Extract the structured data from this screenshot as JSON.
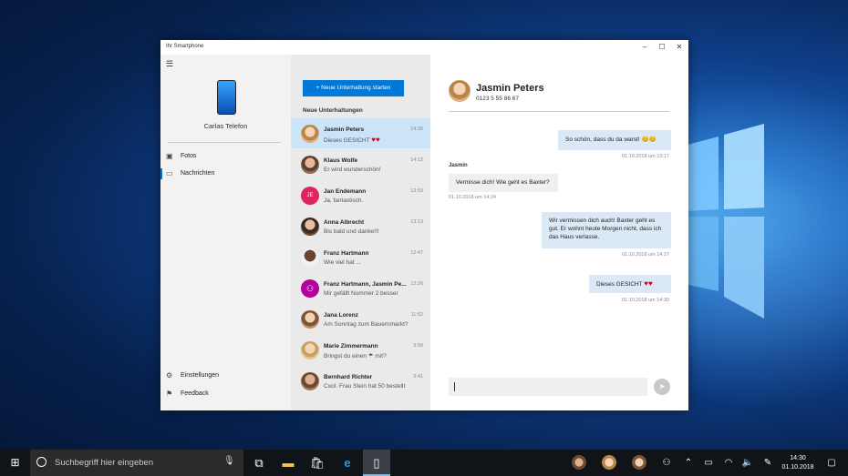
{
  "window": {
    "title": "Ihr Smartphone",
    "controls": {
      "minimize": "–",
      "maximize": "☐",
      "close": "✕"
    }
  },
  "sidebar": {
    "menu_icon": "hamburger-icon",
    "phone_name": "Carlas Telefon",
    "nav": [
      {
        "label": "Fotos",
        "icon": "photo-icon"
      },
      {
        "label": "Nachrichten",
        "icon": "message-icon"
      }
    ],
    "bottom": [
      {
        "label": "Einstellungen",
        "icon": "gear-icon"
      },
      {
        "label": "Feedback",
        "icon": "feedback-icon"
      }
    ]
  },
  "list": {
    "new_button": "Neue Unterhaltung starten",
    "header": "Neue Unterhaltungen",
    "items": [
      {
        "name": "Jasmin Peters",
        "preview": "Dieses GESICHT",
        "time": "14:30",
        "avatar": "photo",
        "selected": true,
        "hearts": true
      },
      {
        "name": "Klaus Wolfe",
        "preview": "Er wird wunderschön!",
        "time": "14:12",
        "avatar": "photo"
      },
      {
        "name": "Jan Endemann",
        "preview": "Ja, fantastisch.",
        "time": "13:59",
        "avatar": "initials",
        "initials": "JE"
      },
      {
        "name": "Anna Albrecht",
        "preview": "Bis bald und danke!!!",
        "time": "13:13",
        "avatar": "photo"
      },
      {
        "name": "Franz Hartmann",
        "preview": "Wie viel hat ...",
        "time": "12:47",
        "avatar": "photo"
      },
      {
        "name": "Franz Hartmann, Jasmin Pe...",
        "preview": "Mir gefällt Nummer 2 besser",
        "time": "12:26",
        "avatar": "group"
      },
      {
        "name": "Jana Lorenz",
        "preview": "Am Sonntag zum Bauernmarkt?",
        "time": "11:52",
        "avatar": "photo"
      },
      {
        "name": "Marie Zimmermann",
        "preview": "Bringst du einen ☂ mit?",
        "time": "9:59",
        "avatar": "photo"
      },
      {
        "name": "Bernhard Richter",
        "preview": "Cool. Frau Stein hat 50 bestellt",
        "time": "9:41",
        "avatar": "photo"
      }
    ]
  },
  "chat": {
    "name": "Jasmin Peters",
    "number": "0123 5 55 86 67",
    "messages": [
      {
        "dir": "out",
        "text": "So schön, dass du da warst! 😊😊",
        "stamp": "01.10.2018 um 13:17"
      },
      {
        "dir": "in",
        "sender": "Jasmin",
        "text": "Vermisse dich! Wie geht es Baxter?",
        "stamp": "01.10.2018 um 14:24"
      },
      {
        "dir": "out",
        "text": "Wir vermissen dich auch! Baxter geht es gut. Er wohnt heute Morgen nicht, dass ich das Haus verlasse.",
        "stamp": "01.10.2018 um 14:27"
      },
      {
        "dir": "out",
        "text": "Dieses GESICHT",
        "stamp": "01.10.2018 um 14:30"
      }
    ],
    "input_placeholder": ""
  },
  "taskbar": {
    "search_placeholder": "Suchbegriff hier eingeben",
    "time": "14:30",
    "date": "01.10.2018"
  }
}
